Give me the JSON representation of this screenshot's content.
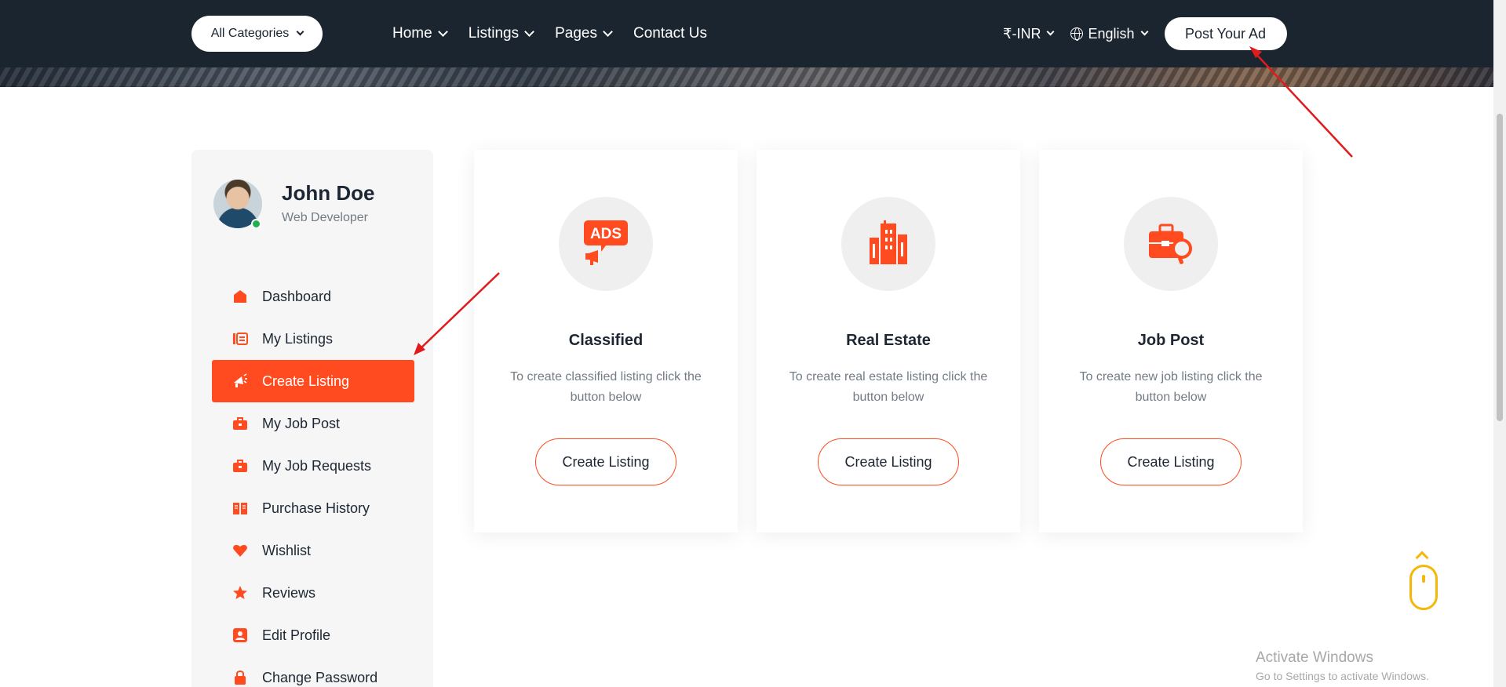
{
  "header": {
    "categories_label": "All Categories",
    "nav": [
      {
        "label": "Home",
        "dropdown": true
      },
      {
        "label": "Listings",
        "dropdown": true
      },
      {
        "label": "Pages",
        "dropdown": true
      },
      {
        "label": "Contact Us",
        "dropdown": false
      }
    ],
    "currency": "₹-INR",
    "language": "English",
    "post_ad_label": "Post Your Ad"
  },
  "profile": {
    "name": "John Doe",
    "role": "Web Developer"
  },
  "sidebar": {
    "items": [
      {
        "label": "Dashboard",
        "icon": "dashboard-icon",
        "active": false
      },
      {
        "label": "My Listings",
        "icon": "listings-icon",
        "active": false
      },
      {
        "label": "Create Listing",
        "icon": "megaphone-icon",
        "active": true
      },
      {
        "label": "My Job Post",
        "icon": "briefcase-icon",
        "active": false
      },
      {
        "label": "My Job Requests",
        "icon": "briefcase-icon",
        "active": false
      },
      {
        "label": "Purchase History",
        "icon": "book-icon",
        "active": false
      },
      {
        "label": "Wishlist",
        "icon": "heart-icon",
        "active": false
      },
      {
        "label": "Reviews",
        "icon": "star-icon",
        "active": false
      },
      {
        "label": "Edit Profile",
        "icon": "user-card-icon",
        "active": false
      },
      {
        "label": "Change Password",
        "icon": "lock-icon",
        "active": false
      }
    ]
  },
  "cards": [
    {
      "title": "Classified",
      "description": "To create classified listing click the button below",
      "button": "Create Listing",
      "icon": "ads-icon"
    },
    {
      "title": "Real Estate",
      "description": "To create real estate listing click the button below",
      "button": "Create Listing",
      "icon": "building-icon"
    },
    {
      "title": "Job Post",
      "description": "To create new job listing click the button below",
      "button": "Create Listing",
      "icon": "briefcase-search-icon"
    }
  ],
  "windows": {
    "line1": "Activate Windows",
    "line2": "Go to Settings to activate Windows."
  },
  "colors": {
    "accent": "#ff4b1f",
    "header_bg": "#1a2530",
    "annotation": "#e01b1b",
    "scroll_widget": "#f5b80a"
  }
}
